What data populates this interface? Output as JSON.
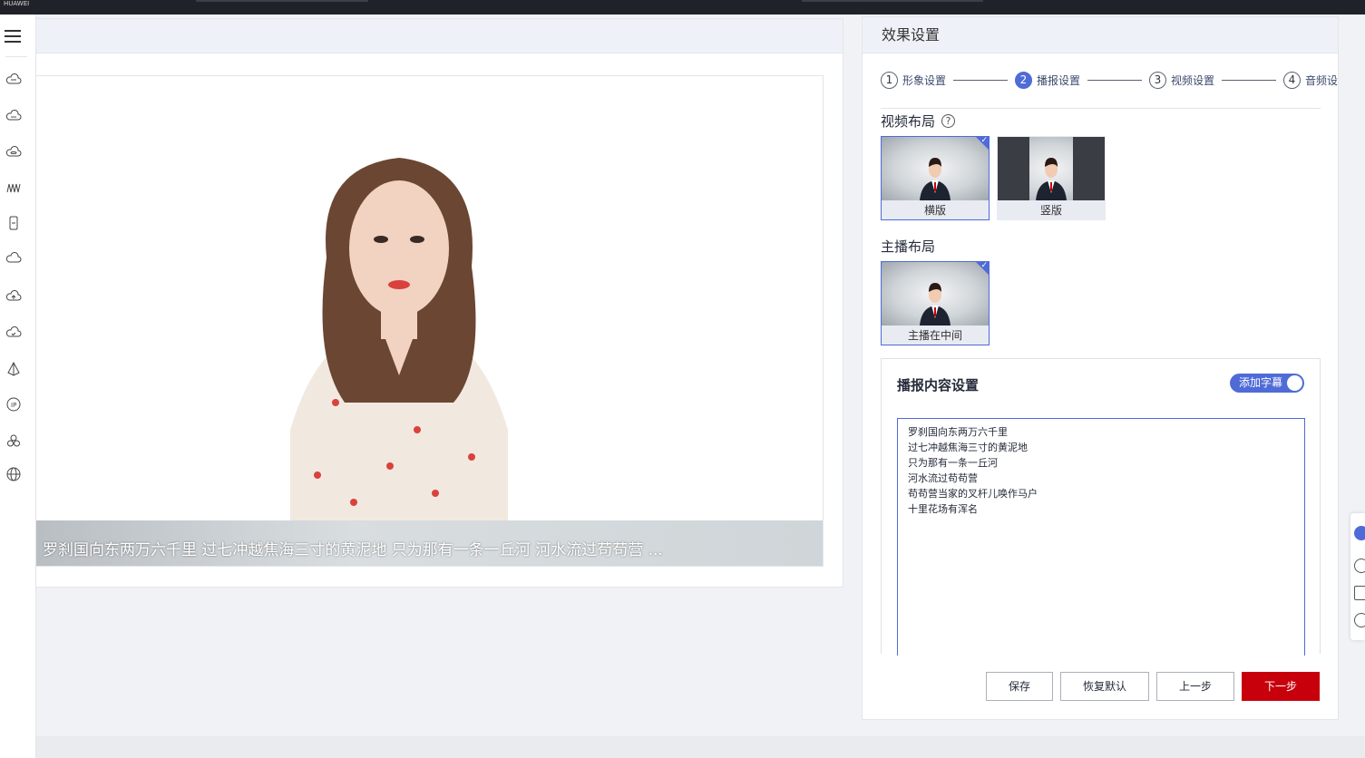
{
  "topbar": {
    "brand": "HUAWEI"
  },
  "sidenav": {
    "icons": [
      "menu-icon",
      "cloud-icon",
      "cloud-dots-icon",
      "cloud-db-icon",
      "waves-icon",
      "phone-icon",
      "cloud-outline-icon",
      "cloud-upload-icon",
      "cloud-check-icon",
      "network-icon",
      "badge-icon",
      "cluster-icon",
      "globe-icon"
    ]
  },
  "preview": {
    "subtitle": "罗刹国向东两万六千里 过七冲越焦海三寸的黄泥地 只为那有一条一丘河 河水流过苟苟营 ..."
  },
  "settings": {
    "title": "效果设置",
    "steps": [
      {
        "num": "1",
        "label": "形象设置"
      },
      {
        "num": "2",
        "label": "播报设置"
      },
      {
        "num": "3",
        "label": "视频设置"
      },
      {
        "num": "4",
        "label": "音频设"
      }
    ],
    "video_layout": {
      "title": "视频布局",
      "help": "?",
      "options": [
        "横版",
        "竖版"
      ]
    },
    "anchor_layout": {
      "title": "主播布局",
      "options": [
        "主播在中间"
      ]
    },
    "content": {
      "title": "播报内容设置",
      "toggle_label": "添加字幕",
      "lines": [
        "罗刹国向东两万六千里",
        "过七冲越焦海三寸的黄泥地",
        "只为那有一条一丘河",
        "河水流过苟苟营",
        "苟苟营当家的叉杆儿唤作马户",
        "十里花场有浑名"
      ]
    },
    "buttons": {
      "save": "保存",
      "reset": "恢复默认",
      "prev": "上一步",
      "next": "下一步"
    }
  },
  "colors": {
    "accent": "#4f6bd7",
    "primary_button": "#c7000b"
  }
}
